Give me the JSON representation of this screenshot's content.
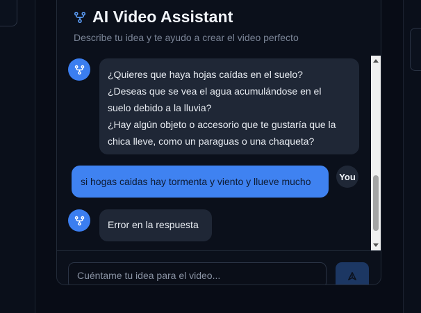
{
  "header": {
    "title": "AI Video Assistant",
    "subtitle": "Describe tu idea y te ayudo a crear el video perfecto",
    "icon": "network-icon"
  },
  "messages": [
    {
      "role": "assistant",
      "lines": [
        "¿Quieres que haya hojas caídas en el suelo?",
        "¿Deseas que se vea el agua acumulándose en el",
        "suelo debido a la lluvia?",
        "¿Hay algún objeto o accesorio que te gustaría que la",
        "chica lleve, como un paraguas o una chaqueta?"
      ]
    },
    {
      "role": "user",
      "text": "si hogas caidas hay tormenta y viento y llueve mucho",
      "avatar_label": "You"
    },
    {
      "role": "assistant",
      "text": "Error en la respuesta"
    }
  ],
  "input": {
    "placeholder": "Cuéntame tu idea para el video..."
  },
  "colors": {
    "accent": "#3f82f1",
    "background": "#080c16",
    "bubble": "#1f2736"
  }
}
